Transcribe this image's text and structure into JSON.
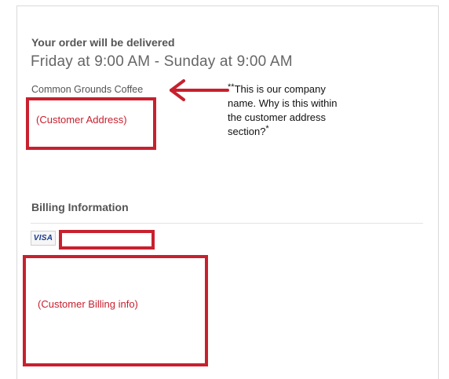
{
  "delivery": {
    "label": "Your order will be delivered",
    "window": "Friday at 9:00 AM - Sunday at 9:00 AM",
    "company_name": "Common Grounds Coffee",
    "address_placeholder": "(Customer Address)"
  },
  "annotation": {
    "lead_mark": "**",
    "text": "This is our company name. Why is this within the customer address section?",
    "tail_mark": "*"
  },
  "billing": {
    "title": "Billing Information",
    "card_brand": "VISA",
    "billing_placeholder": "(Customer Billing info)"
  },
  "colors": {
    "redaction": "#c8202e",
    "text_gray": "#555555",
    "visa_blue": "#1a3a8f"
  },
  "icons": {
    "arrow": "arrow-left-icon",
    "card": "visa-card-icon"
  }
}
